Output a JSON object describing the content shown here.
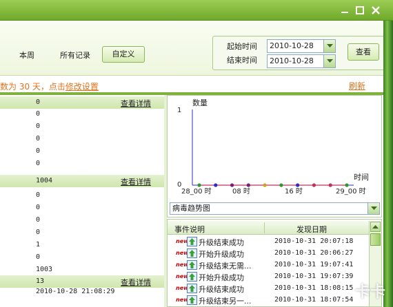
{
  "toolbar": {
    "this_week": "本周",
    "all_records": "所有记录",
    "custom": "自定义",
    "start_label": "起始时间",
    "end_label": "结束时间",
    "start_date": "2010-10-28",
    "end_date": "2010-10-28",
    "query": "查看"
  },
  "info": {
    "prefix": "数为 30 天，点击",
    "link": "修改设置",
    "refresh": "刷新"
  },
  "left": {
    "sections": [
      {
        "count": "0",
        "link": "查看详情",
        "rows": [
          "0",
          "0",
          "0",
          "0",
          "0"
        ]
      },
      {
        "count": "1004",
        "link": "查看详情",
        "rows": [
          "0",
          "0",
          "0",
          "0",
          "1",
          "0",
          "1003"
        ]
      },
      {
        "count": "13",
        "link": "查看详情",
        "rows": [
          "2010-10-28 21:08:29"
        ]
      }
    ]
  },
  "chart_data": {
    "type": "line",
    "ylabel": "数量",
    "xlabel": "时间",
    "ylim": [
      0,
      1
    ],
    "y_ticks": [
      "1",
      "0"
    ],
    "x_tick_labels": [
      "28_00 时",
      "08 时",
      "16 时",
      "29_00 时"
    ],
    "series": [
      {
        "values": [
          0,
          0,
          0,
          0,
          0,
          0,
          0,
          0,
          0,
          0
        ]
      }
    ],
    "series_colors": [
      "#2b9a2b",
      "#2a2ad0",
      "#7a1a7a",
      "#7a1a7a",
      "#d4a017",
      "#2b9a2b",
      "#2a2ad0",
      "#c0305a",
      "#c0305a",
      "#2b9a2b"
    ],
    "grid": false,
    "legend": "none",
    "select": "病毒趋势图"
  },
  "events": {
    "col_desc": "事件说明",
    "col_date": "发现日期",
    "new_tag": "new",
    "rows": [
      {
        "desc": "升级结束成功",
        "date": "2010-10-31 20:07:18"
      },
      {
        "desc": "开始升级成功",
        "date": "2010-10-31 20:06:27"
      },
      {
        "desc": "升级结束无需...",
        "date": "2010-10-31 19:07:41"
      },
      {
        "desc": "开始升级成功",
        "date": "2010-10-31 19:07:39"
      },
      {
        "desc": "升级结束成功",
        "date": "2010-10-31 18:08:15"
      },
      {
        "desc": "升级结束另一...",
        "date": "2010-10-31 18:07:54"
      }
    ]
  },
  "watermark": "卡卡",
  "colors": {
    "accent": "#7fb23c",
    "link_orange": "#e0731c"
  }
}
